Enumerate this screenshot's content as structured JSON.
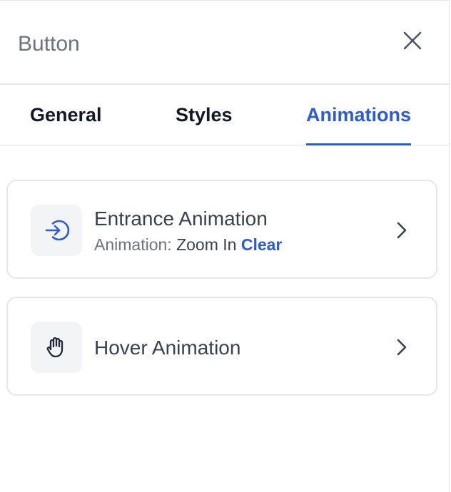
{
  "header": {
    "title": "Button",
    "close_icon": "close-icon"
  },
  "tabs": [
    {
      "label": "General",
      "active": false
    },
    {
      "label": "Styles",
      "active": false
    },
    {
      "label": "Animations",
      "active": true
    }
  ],
  "cards": {
    "entrance": {
      "title": "Entrance Animation",
      "sub_label": "Animation:",
      "sub_value": "Zoom In",
      "clear_label": "Clear",
      "icon": "enter-arrow-icon"
    },
    "hover": {
      "title": "Hover Animation",
      "icon": "hand-icon"
    }
  },
  "colors": {
    "accent": "#2b5bd7",
    "text": "#374151",
    "muted": "#6b7280",
    "border": "#e5e7eb",
    "icon_bg": "#f3f4f6"
  }
}
